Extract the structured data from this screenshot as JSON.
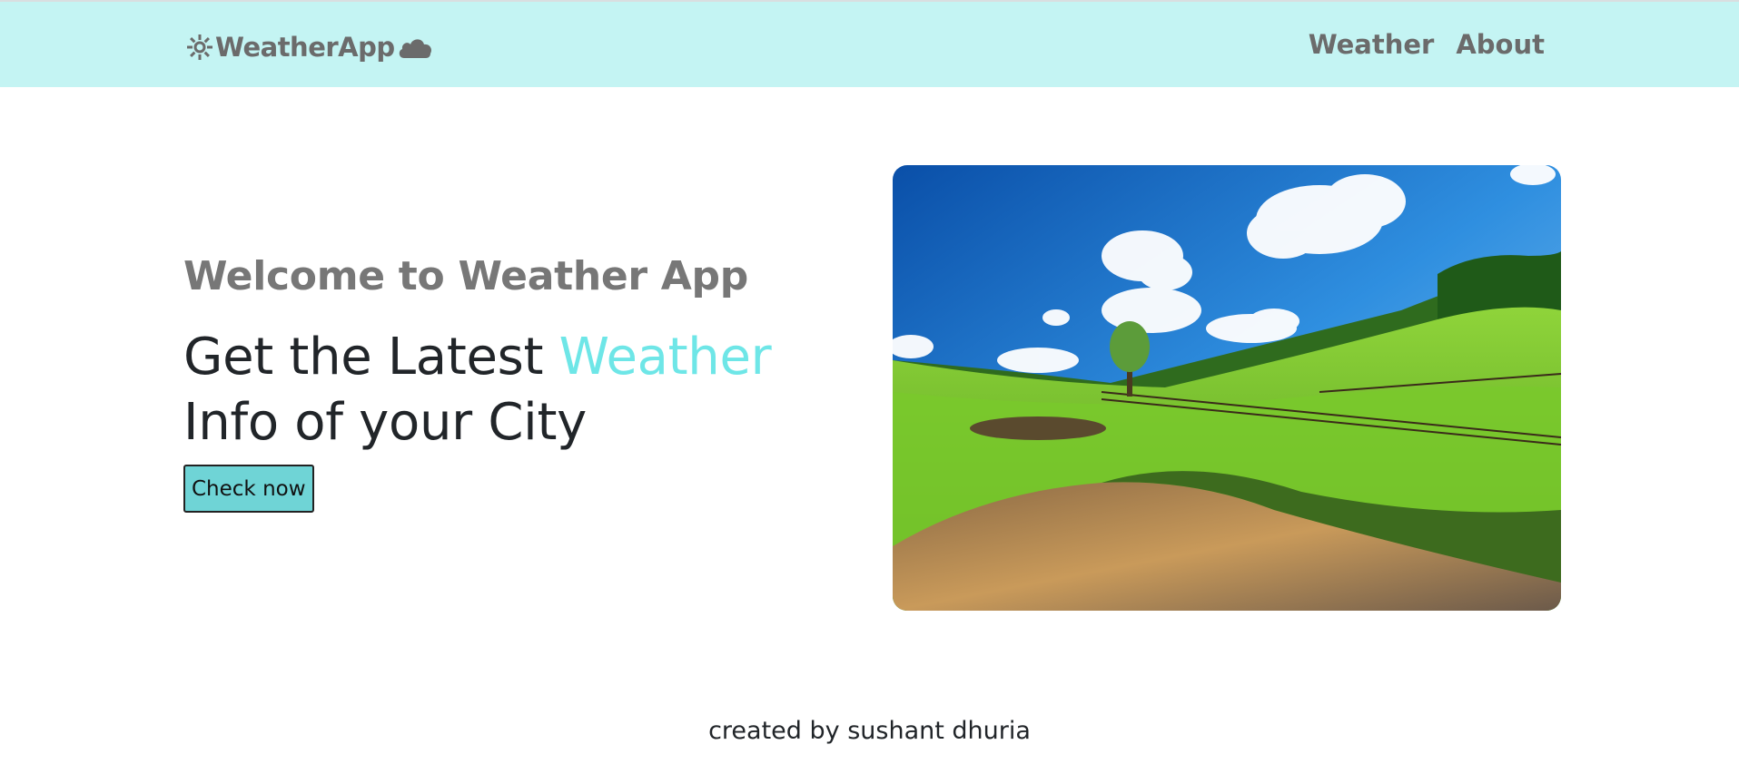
{
  "navbar": {
    "brand": "WeatherApp",
    "brand_icons": [
      "sun-icon",
      "cloud-icon"
    ],
    "links": [
      {
        "label": "Weather"
      },
      {
        "label": "About"
      }
    ],
    "background": "#c4f4f3"
  },
  "hero": {
    "welcome": "Welcome to Weather App",
    "headline_part1": "Get the Latest ",
    "headline_accent": "Weather",
    "headline_part2": "Info of your City",
    "accent_color": "#6ee6e7",
    "button_label": "Check now",
    "button_color": "#6fd4d6",
    "image": "landscape-image"
  },
  "footer": {
    "text": "created by sushant dhuria"
  }
}
